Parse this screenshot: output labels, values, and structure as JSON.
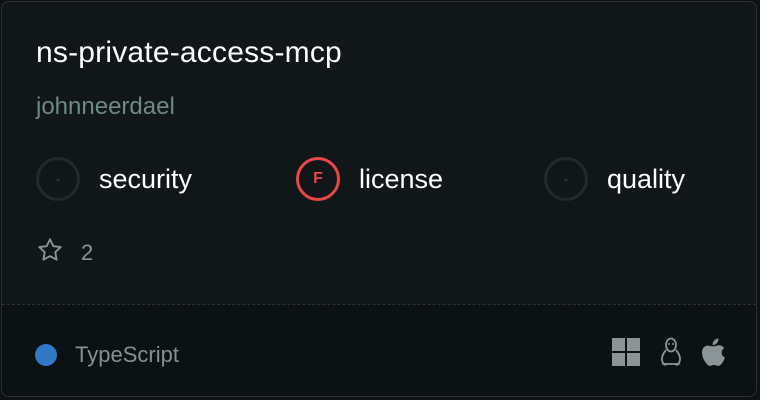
{
  "repo": {
    "name": "ns-private-access-mcp",
    "owner": "johnneerdael"
  },
  "scores": [
    {
      "grade": "-",
      "label": "security",
      "status": "none"
    },
    {
      "grade": "F",
      "label": "license",
      "status": "fail",
      "color": "#e8474b"
    },
    {
      "grade": "-",
      "label": "quality",
      "status": "none"
    }
  ],
  "stars": {
    "icon": "star-icon",
    "count": "2"
  },
  "language": {
    "name": "TypeScript",
    "color": "#3178c6"
  },
  "platforms": [
    "windows-icon",
    "linux-icon",
    "apple-icon"
  ]
}
